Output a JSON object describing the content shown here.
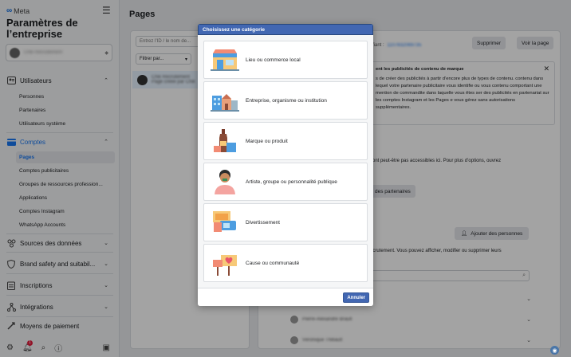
{
  "sidebar": {
    "logo": "Meta",
    "title": "Paramètres de l’entreprise",
    "account_name": "Chik Recrutement",
    "sections": [
      {
        "label": "Utilisateurs",
        "icon": "users-icon",
        "items": [
          "Personnes",
          "Partenaires",
          "Utilisateurs système"
        ]
      },
      {
        "label": "Comptes",
        "icon": "accounts-icon",
        "items": [
          "Pages",
          "Comptes publicitaires",
          "Groupes de ressources profession...",
          "Applications",
          "Comptes Instagram",
          "WhatsApp Accounts"
        ]
      },
      {
        "label": "Sources des données",
        "icon": "data-sources-icon"
      },
      {
        "label": "Brand safety and suitabil...",
        "icon": "shield-icon"
      },
      {
        "label": "Inscriptions",
        "icon": "registrations-icon"
      },
      {
        "label": "Intégrations",
        "icon": "integrations-icon"
      },
      {
        "label": "Moyens de paiement",
        "icon": "payment-icon"
      }
    ],
    "bell_badge": "1"
  },
  "main": {
    "title": "Pages",
    "search_placeholder": "Entrez l’ID / le nom de...",
    "filter_label": "Filtrer par...",
    "page_item_name": "Chik Recrutement",
    "page_item_sub": "Page créée par Chik",
    "delete_button": "Supprimer",
    "view_button": "Voir la page",
    "identifier_label": "tifiant :",
    "identifier_value": "1107832069735",
    "notice_title": "ent les publicités de contenu de marque",
    "notice_body": "s de créer des publicités à partir d’encore plus de types de contenu. contenu dans lequel votre partenaire publicitaire vous identifie ou vous contenu comportant une mention de commandite dans laquelle vous êtes ser des publicités en partenariat sur les comptes Instagram et les Pages e vous gérez sans autorisations supplémentaires.",
    "perm_text_title": "s",
    "perm_text": "sont peut-être pas accessibles ici. Pour plus d’options, ouvrez",
    "partners_button": "des partenaires",
    "add_people_button": "Ajouter des personnes",
    "people_text": "ecrutement. Vous pouvez afficher, modifier ou supprimer leurs",
    "people": [
      "Pierre-Alexandre Brault",
      "Véronique Thibault"
    ]
  },
  "modal": {
    "title": "Choisissez une catégorie",
    "categories": [
      {
        "label": "Lieu ou commerce local",
        "icon": "storefront-icon"
      },
      {
        "label": "Entreprise, organisme ou institution",
        "icon": "building-icon"
      },
      {
        "label": "Marque ou produit",
        "icon": "product-icon"
      },
      {
        "label": "Artiste, groupe ou personnalité publique",
        "icon": "artist-icon"
      },
      {
        "label": "Divertissement",
        "icon": "entertainment-icon"
      },
      {
        "label": "Cause ou communauté",
        "icon": "cause-icon"
      }
    ],
    "cancel_button": "Annuler"
  },
  "colors": {
    "brand_blue": "#1877f2",
    "modal_header": "#4267b2"
  }
}
